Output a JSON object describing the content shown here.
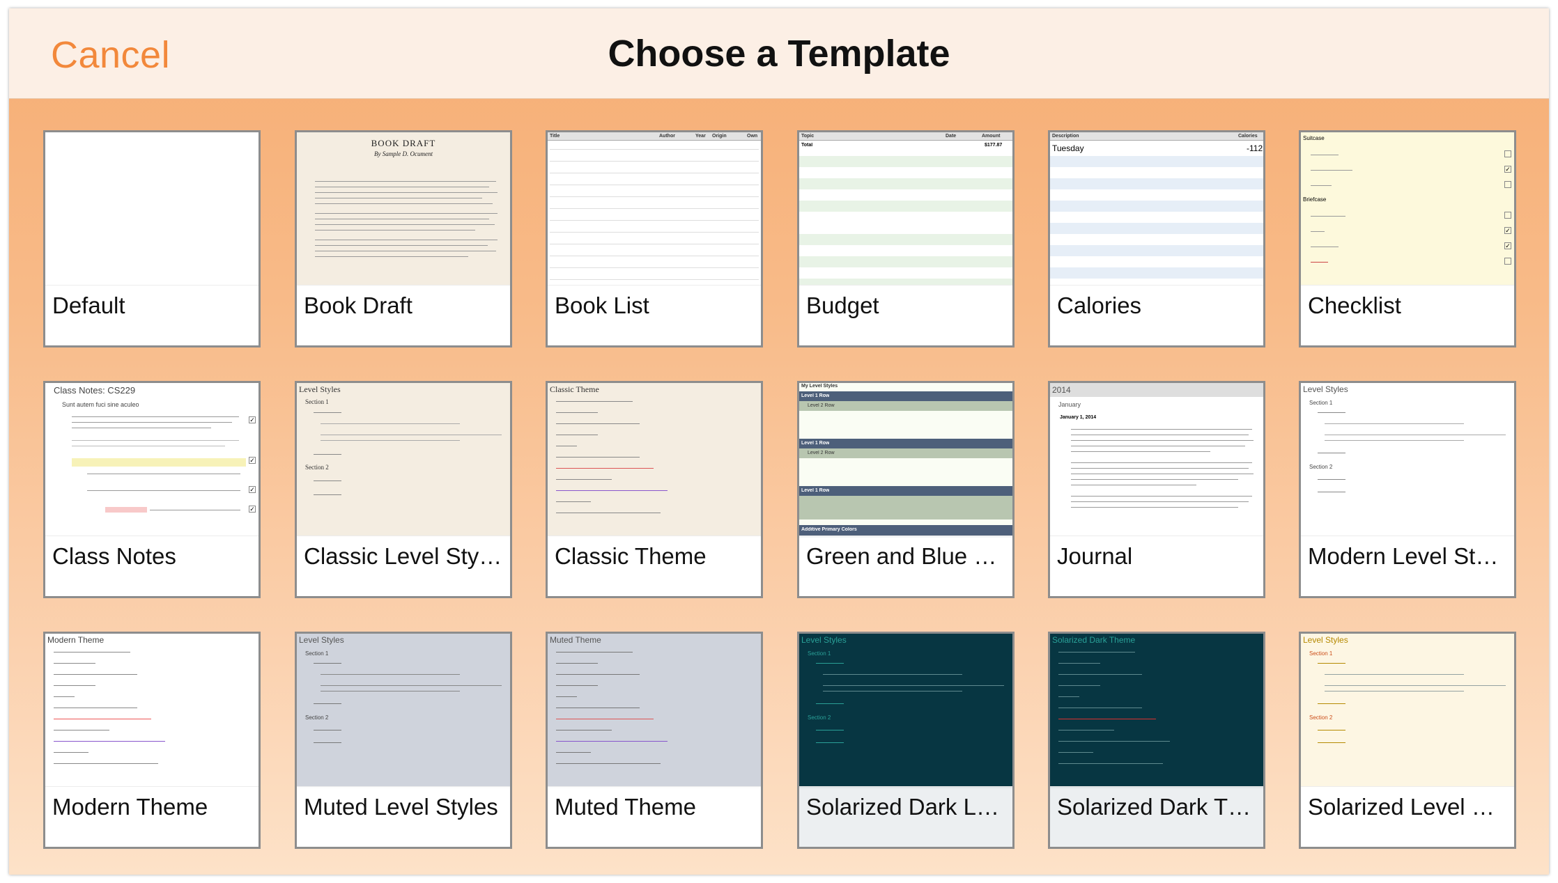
{
  "header": {
    "cancel_label": "Cancel",
    "title": "Choose a Template"
  },
  "templates": [
    {
      "name": "Default"
    },
    {
      "name": "Book Draft",
      "heading": "BOOK DRAFT",
      "subheading": "By Sample D. Ocument"
    },
    {
      "name": "Book List",
      "columns": [
        "Title",
        "Author",
        "Year",
        "Origin",
        "Own"
      ]
    },
    {
      "name": "Budget",
      "columns": [
        "Topic",
        "Date",
        "Amount"
      ],
      "total_label": "Total",
      "total_value": "$177.87"
    },
    {
      "name": "Calories",
      "columns": [
        "Description",
        "Calories"
      ],
      "day": "Tuesday",
      "day_value": "-112"
    },
    {
      "name": "Checklist",
      "groups": [
        "Suitcase",
        "Briefcase"
      ]
    },
    {
      "name": "Class Notes",
      "heading": "Class Notes: CS229",
      "subheading": "Sunt autem fuci sine aculeo"
    },
    {
      "name": "Classic Level Styles",
      "heading": "Level Styles",
      "section1": "Section 1",
      "section2": "Section 2"
    },
    {
      "name": "Classic Theme",
      "heading": "Classic Theme"
    },
    {
      "name": "Green and Blue Le…",
      "heading": "My Level Styles",
      "row1": "Level 1 Row",
      "row2": "Level 2 Row",
      "footer": "Additive Primary Colors"
    },
    {
      "name": "Journal",
      "heading": "2014",
      "month": "January",
      "date": "January 1, 2014"
    },
    {
      "name": "Modern Level Styles",
      "heading": "Level Styles",
      "section1": "Section 1",
      "section2": "Section 2"
    },
    {
      "name": "Modern Theme",
      "heading": "Modern Theme"
    },
    {
      "name": "Muted Level Styles",
      "heading": "Level Styles",
      "section1": "Section 1",
      "section2": "Section 2"
    },
    {
      "name": "Muted Theme",
      "heading": "Muted Theme"
    },
    {
      "name": "Solarized Dark Le…",
      "heading": "Level Styles",
      "section1": "Section 1",
      "section2": "Section 2"
    },
    {
      "name": "Solarized Dark Th…",
      "heading": "Solarized Dark Theme"
    },
    {
      "name": "Solarized Level St…",
      "heading": "Level Styles",
      "section1": "Section 1",
      "section2": "Section 2"
    }
  ],
  "colors": {
    "accent": "#f2883b",
    "header_bg": "#fcefe5",
    "solarized_bg": "#073642",
    "solarized_light_bg": "#fdf6e3",
    "muted_bg": "#cfd3dc"
  }
}
